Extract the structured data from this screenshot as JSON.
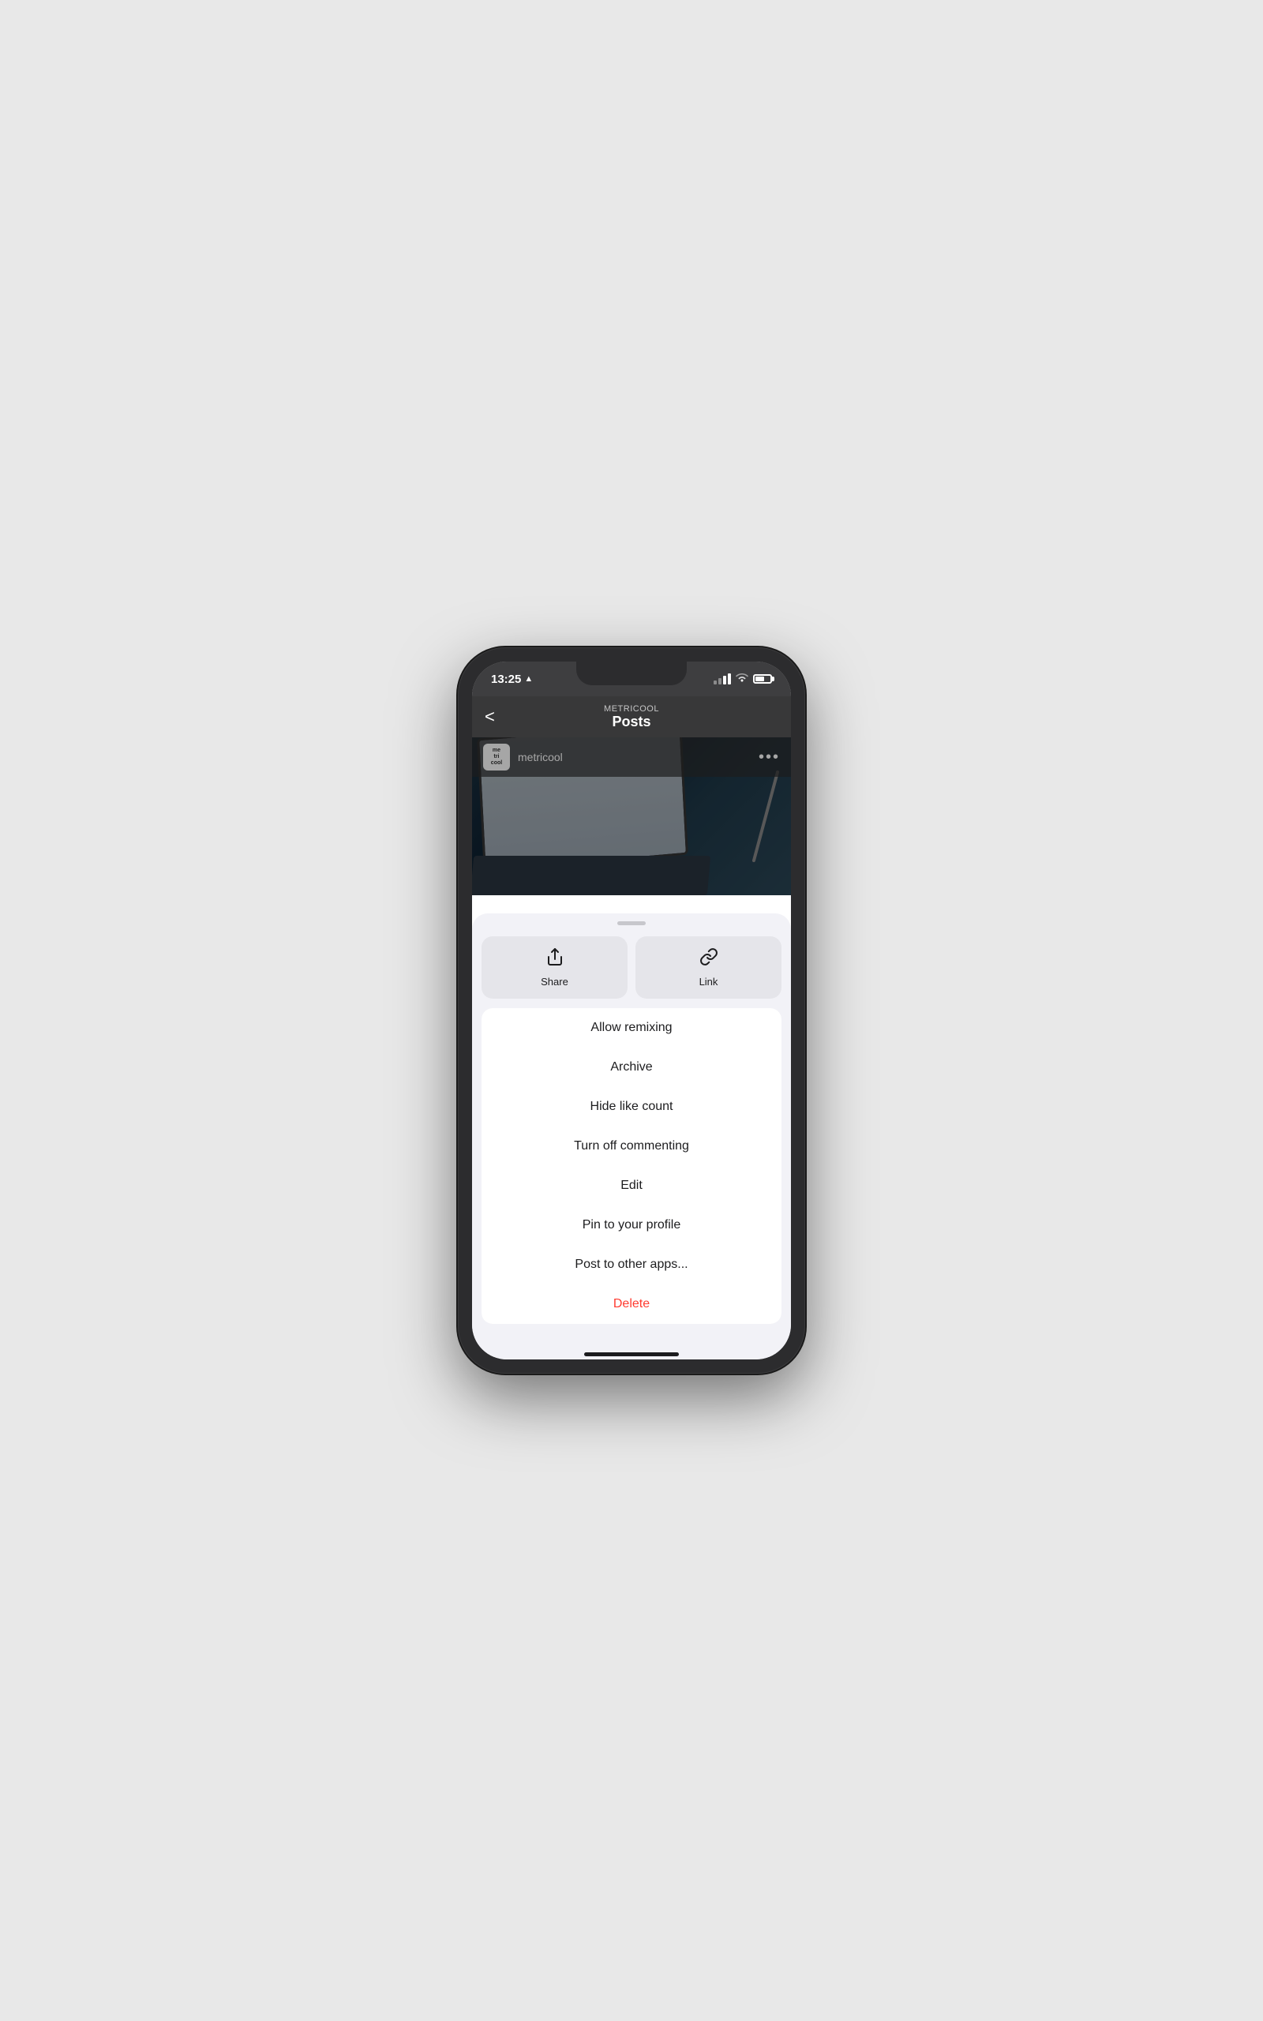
{
  "status_bar": {
    "time": "13:25",
    "direction_icon": "▲"
  },
  "header": {
    "app_name": "METRICOOL",
    "title": "Posts",
    "back_label": "<"
  },
  "post": {
    "username": "metricool",
    "avatar_lines": [
      "me",
      "tri",
      "cool"
    ],
    "more_icon": "•••"
  },
  "sheet": {
    "handle_label": "",
    "actions": [
      {
        "icon": "share",
        "label": "Share"
      },
      {
        "icon": "link",
        "label": "Link"
      }
    ],
    "menu_items": [
      {
        "id": "allow-remixing",
        "label": "Allow remixing",
        "color": "normal"
      },
      {
        "id": "archive",
        "label": "Archive",
        "color": "normal"
      },
      {
        "id": "hide-like-count",
        "label": "Hide like count",
        "color": "normal"
      },
      {
        "id": "turn-off-commenting",
        "label": "Turn off commenting",
        "color": "normal"
      },
      {
        "id": "edit",
        "label": "Edit",
        "color": "normal"
      },
      {
        "id": "pin-to-profile",
        "label": "Pin to your profile",
        "color": "normal"
      },
      {
        "id": "post-to-other-apps",
        "label": "Post to other apps...",
        "color": "normal"
      },
      {
        "id": "delete",
        "label": "Delete",
        "color": "delete"
      }
    ]
  },
  "home_indicator": ""
}
